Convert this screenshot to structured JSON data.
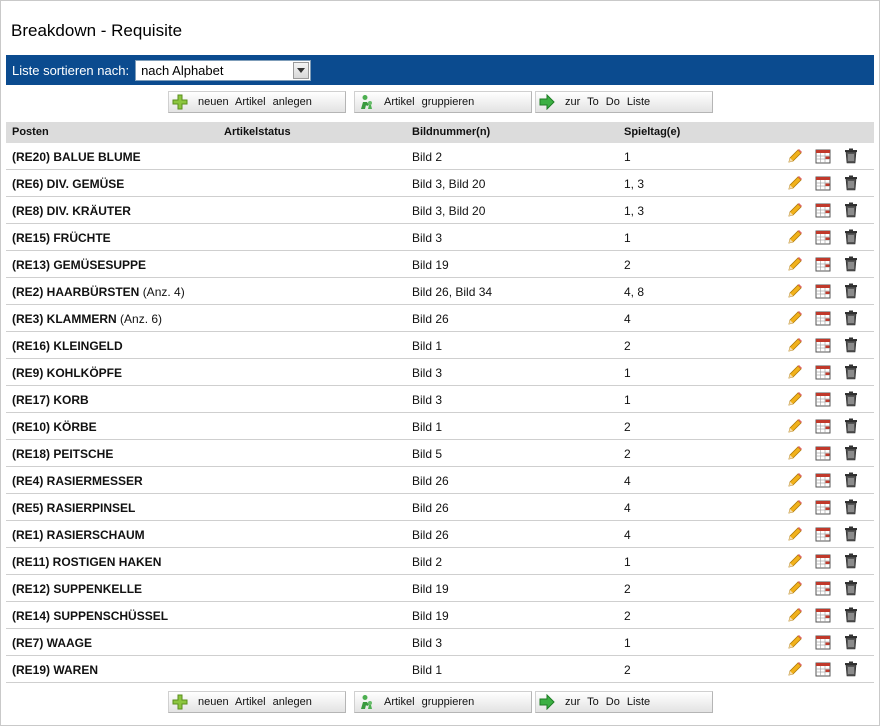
{
  "page_title": "Breakdown - Requisite",
  "sort": {
    "label": "Liste sortieren nach:",
    "selected": "nach Alphabet"
  },
  "buttons": {
    "new": "neuen Artikel anlegen",
    "group": "Artikel gruppieren",
    "todo": "zur To Do Liste"
  },
  "columns": {
    "post": "Posten",
    "status": "Artikelstatus",
    "bild": "Bildnummer(n)",
    "tag": "Spieltag(e)"
  },
  "rows": [
    {
      "post": "(RE20) BALUE BLUME",
      "extra": "",
      "status": "",
      "bild": "Bild 2",
      "tag": "1"
    },
    {
      "post": "(RE6) DIV. GEMÜSE",
      "extra": "",
      "status": "",
      "bild": "Bild 3, Bild 20",
      "tag": "1, 3"
    },
    {
      "post": "(RE8) DIV. KRÄUTER",
      "extra": "",
      "status": "",
      "bild": "Bild 3, Bild 20",
      "tag": "1, 3"
    },
    {
      "post": "(RE15) FRÜCHTE",
      "extra": "",
      "status": "",
      "bild": "Bild 3",
      "tag": "1"
    },
    {
      "post": "(RE13) GEMÜSESUPPE",
      "extra": "",
      "status": "",
      "bild": "Bild 19",
      "tag": "2"
    },
    {
      "post": "(RE2) HAARBÜRSTEN",
      "extra": "(Anz. 4)",
      "status": "",
      "bild": "Bild 26, Bild 34",
      "tag": "4, 8"
    },
    {
      "post": "(RE3) KLAMMERN",
      "extra": "(Anz. 6)",
      "status": "",
      "bild": "Bild 26",
      "tag": "4"
    },
    {
      "post": "(RE16) KLEINGELD",
      "extra": "",
      "status": "",
      "bild": "Bild 1",
      "tag": "2"
    },
    {
      "post": "(RE9) KOHLKÖPFE",
      "extra": "",
      "status": "",
      "bild": "Bild 3",
      "tag": "1"
    },
    {
      "post": "(RE17) KORB",
      "extra": "",
      "status": "",
      "bild": "Bild 3",
      "tag": "1"
    },
    {
      "post": "(RE10) KÖRBE",
      "extra": "",
      "status": "",
      "bild": "Bild 1",
      "tag": "2"
    },
    {
      "post": "(RE18) PEITSCHE",
      "extra": "",
      "status": "",
      "bild": "Bild 5",
      "tag": "2"
    },
    {
      "post": "(RE4) RASIERMESSER",
      "extra": "",
      "status": "",
      "bild": "Bild 26",
      "tag": "4"
    },
    {
      "post": "(RE5) RASIERPINSEL",
      "extra": "",
      "status": "",
      "bild": "Bild 26",
      "tag": "4"
    },
    {
      "post": "(RE1) RASIERSCHAUM",
      "extra": "",
      "status": "",
      "bild": "Bild 26",
      "tag": "4"
    },
    {
      "post": "(RE11) ROSTIGEN HAKEN",
      "extra": "",
      "status": "",
      "bild": "Bild 2",
      "tag": "1"
    },
    {
      "post": "(RE12) SUPPENKELLE",
      "extra": "",
      "status": "",
      "bild": "Bild 19",
      "tag": "2"
    },
    {
      "post": "(RE14) SUPPENSCHÜSSEL",
      "extra": "",
      "status": "",
      "bild": "Bild 19",
      "tag": "2"
    },
    {
      "post": "(RE7) WAAGE",
      "extra": "",
      "status": "",
      "bild": "Bild 3",
      "tag": "1"
    },
    {
      "post": "(RE19) WAREN",
      "extra": "",
      "status": "",
      "bild": "Bild 1",
      "tag": "2"
    }
  ],
  "colors": {
    "header_bar": "#0b4b8f",
    "table_header": "#dcdcdc"
  },
  "icons": {
    "new": "plus-icon",
    "group": "group-icon",
    "todo": "arrow-right-icon",
    "edit": "pencil-icon",
    "calendar": "calendar-icon",
    "delete": "trash-icon"
  }
}
